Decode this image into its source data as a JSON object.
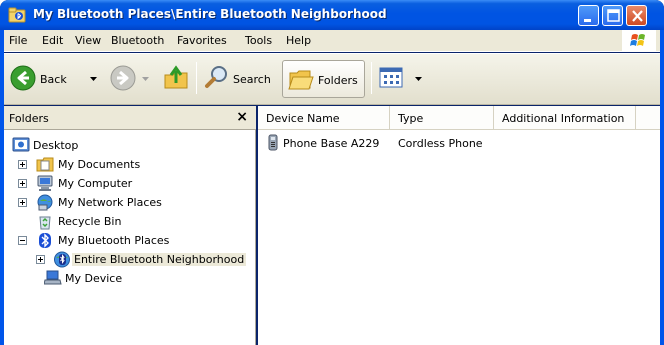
{
  "window": {
    "title": "My Bluetooth Places\\Entire Bluetooth Neighborhood",
    "app_icon": "bluetooth-folder-icon"
  },
  "menu": {
    "items": [
      "File",
      "Edit",
      "View",
      "Bluetooth",
      "Favorites",
      "Tools",
      "Help"
    ]
  },
  "toolbar": {
    "back_label": "Back",
    "search_label": "Search",
    "folders_label": "Folders"
  },
  "folders_pane": {
    "title": "Folders",
    "close_glyph": "×",
    "tree": [
      {
        "label": "Desktop",
        "icon": "desktop-icon"
      },
      {
        "label": "My Documents",
        "icon": "documents-folder-icon"
      },
      {
        "label": "My Computer",
        "icon": "computer-icon"
      },
      {
        "label": "My Network Places",
        "icon": "network-places-icon"
      },
      {
        "label": "Recycle Bin",
        "icon": "recycle-bin-icon"
      },
      {
        "label": "My Bluetooth Places",
        "icon": "bluetooth-icon"
      },
      {
        "label": "Entire Bluetooth Neighborhood",
        "icon": "bluetooth-neighborhood-icon"
      },
      {
        "label": "My Device",
        "icon": "my-device-icon"
      }
    ]
  },
  "list_view": {
    "columns": [
      "Device Name",
      "Type",
      "Additional Information"
    ],
    "rows": [
      {
        "device_name": "Phone Base  A229",
        "type": "Cordless Phone",
        "additional_information": "",
        "icon": "cordless-phone-icon"
      }
    ]
  }
}
